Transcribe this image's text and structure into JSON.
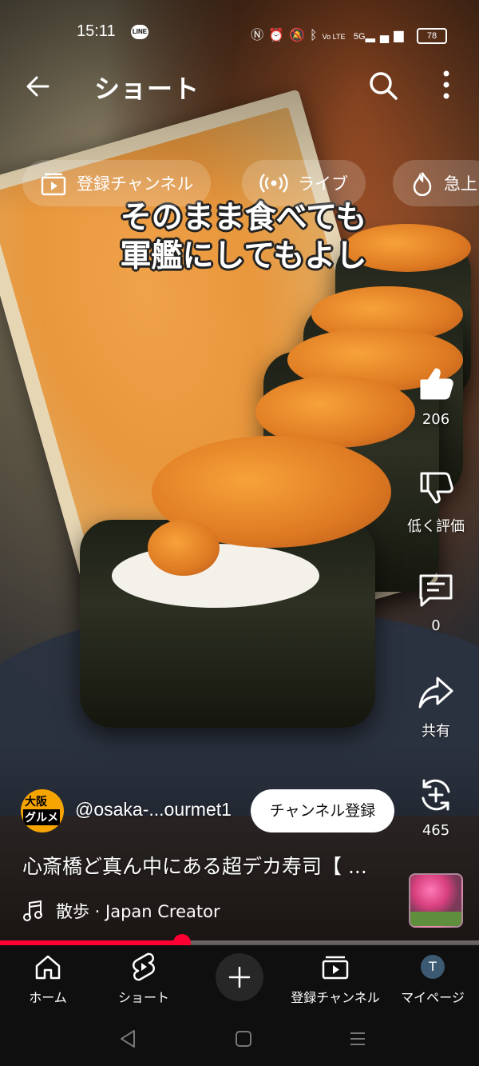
{
  "status_bar": {
    "time": "15:11",
    "line_badge": "LINE",
    "icons": [
      "nfc-icon",
      "alarm-icon",
      "mute-icon",
      "bluetooth-icon",
      "volte-icon",
      "5g-signal-icon"
    ],
    "volte_text": "Vo LTE",
    "network": "5G",
    "battery": "78"
  },
  "app_bar": {
    "title": "ショート"
  },
  "chips": [
    {
      "label": "登録チャンネル",
      "icon": "subscriptions-icon"
    },
    {
      "label": "ライブ",
      "icon": "live-icon"
    },
    {
      "label": "急上",
      "icon": "trending-icon"
    }
  ],
  "video": {
    "caption_line1": "そのまま食べても",
    "caption_line2": "軍艦にしてもよし"
  },
  "actions": {
    "like_count": "206",
    "dislike_label": "低く評価",
    "comment_count": "0",
    "share_label": "共有",
    "remix_count": "465"
  },
  "channel": {
    "avatar_line1": "大阪",
    "avatar_line2": "グルメ",
    "handle": "@osaka-...ourmet1",
    "subscribe_label": "チャンネル登録"
  },
  "video_title": "心斎橋ど真ん中にある超デカ寿司【 ...",
  "music": "散歩 · Japan Creator",
  "progress": 0.38,
  "nav": {
    "home": "ホーム",
    "shorts": "ショート",
    "subscriptions": "登録チャンネル",
    "you": "マイページ",
    "avatar_letter": "T"
  },
  "colors": {
    "accent": "#ff0033",
    "nav_bg": "#0f0f0f"
  }
}
